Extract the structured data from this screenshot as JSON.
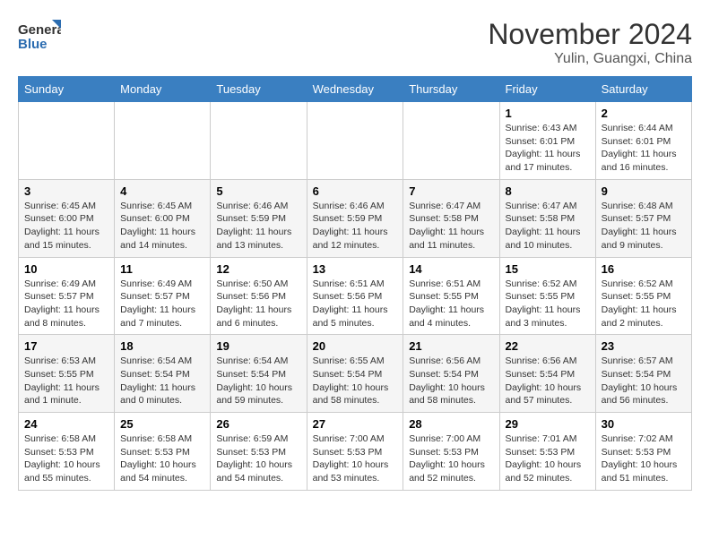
{
  "logo": {
    "line1": "General",
    "line2": "Blue"
  },
  "title": "November 2024",
  "location": "Yulin, Guangxi, China",
  "weekdays": [
    "Sunday",
    "Monday",
    "Tuesday",
    "Wednesday",
    "Thursday",
    "Friday",
    "Saturday"
  ],
  "weeks": [
    [
      {
        "day": "",
        "info": ""
      },
      {
        "day": "",
        "info": ""
      },
      {
        "day": "",
        "info": ""
      },
      {
        "day": "",
        "info": ""
      },
      {
        "day": "",
        "info": ""
      },
      {
        "day": "1",
        "info": "Sunrise: 6:43 AM\nSunset: 6:01 PM\nDaylight: 11 hours and 17 minutes."
      },
      {
        "day": "2",
        "info": "Sunrise: 6:44 AM\nSunset: 6:01 PM\nDaylight: 11 hours and 16 minutes."
      }
    ],
    [
      {
        "day": "3",
        "info": "Sunrise: 6:45 AM\nSunset: 6:00 PM\nDaylight: 11 hours and 15 minutes."
      },
      {
        "day": "4",
        "info": "Sunrise: 6:45 AM\nSunset: 6:00 PM\nDaylight: 11 hours and 14 minutes."
      },
      {
        "day": "5",
        "info": "Sunrise: 6:46 AM\nSunset: 5:59 PM\nDaylight: 11 hours and 13 minutes."
      },
      {
        "day": "6",
        "info": "Sunrise: 6:46 AM\nSunset: 5:59 PM\nDaylight: 11 hours and 12 minutes."
      },
      {
        "day": "7",
        "info": "Sunrise: 6:47 AM\nSunset: 5:58 PM\nDaylight: 11 hours and 11 minutes."
      },
      {
        "day": "8",
        "info": "Sunrise: 6:47 AM\nSunset: 5:58 PM\nDaylight: 11 hours and 10 minutes."
      },
      {
        "day": "9",
        "info": "Sunrise: 6:48 AM\nSunset: 5:57 PM\nDaylight: 11 hours and 9 minutes."
      }
    ],
    [
      {
        "day": "10",
        "info": "Sunrise: 6:49 AM\nSunset: 5:57 PM\nDaylight: 11 hours and 8 minutes."
      },
      {
        "day": "11",
        "info": "Sunrise: 6:49 AM\nSunset: 5:57 PM\nDaylight: 11 hours and 7 minutes."
      },
      {
        "day": "12",
        "info": "Sunrise: 6:50 AM\nSunset: 5:56 PM\nDaylight: 11 hours and 6 minutes."
      },
      {
        "day": "13",
        "info": "Sunrise: 6:51 AM\nSunset: 5:56 PM\nDaylight: 11 hours and 5 minutes."
      },
      {
        "day": "14",
        "info": "Sunrise: 6:51 AM\nSunset: 5:55 PM\nDaylight: 11 hours and 4 minutes."
      },
      {
        "day": "15",
        "info": "Sunrise: 6:52 AM\nSunset: 5:55 PM\nDaylight: 11 hours and 3 minutes."
      },
      {
        "day": "16",
        "info": "Sunrise: 6:52 AM\nSunset: 5:55 PM\nDaylight: 11 hours and 2 minutes."
      }
    ],
    [
      {
        "day": "17",
        "info": "Sunrise: 6:53 AM\nSunset: 5:55 PM\nDaylight: 11 hours and 1 minute."
      },
      {
        "day": "18",
        "info": "Sunrise: 6:54 AM\nSunset: 5:54 PM\nDaylight: 11 hours and 0 minutes."
      },
      {
        "day": "19",
        "info": "Sunrise: 6:54 AM\nSunset: 5:54 PM\nDaylight: 10 hours and 59 minutes."
      },
      {
        "day": "20",
        "info": "Sunrise: 6:55 AM\nSunset: 5:54 PM\nDaylight: 10 hours and 58 minutes."
      },
      {
        "day": "21",
        "info": "Sunrise: 6:56 AM\nSunset: 5:54 PM\nDaylight: 10 hours and 58 minutes."
      },
      {
        "day": "22",
        "info": "Sunrise: 6:56 AM\nSunset: 5:54 PM\nDaylight: 10 hours and 57 minutes."
      },
      {
        "day": "23",
        "info": "Sunrise: 6:57 AM\nSunset: 5:54 PM\nDaylight: 10 hours and 56 minutes."
      }
    ],
    [
      {
        "day": "24",
        "info": "Sunrise: 6:58 AM\nSunset: 5:53 PM\nDaylight: 10 hours and 55 minutes."
      },
      {
        "day": "25",
        "info": "Sunrise: 6:58 AM\nSunset: 5:53 PM\nDaylight: 10 hours and 54 minutes."
      },
      {
        "day": "26",
        "info": "Sunrise: 6:59 AM\nSunset: 5:53 PM\nDaylight: 10 hours and 54 minutes."
      },
      {
        "day": "27",
        "info": "Sunrise: 7:00 AM\nSunset: 5:53 PM\nDaylight: 10 hours and 53 minutes."
      },
      {
        "day": "28",
        "info": "Sunrise: 7:00 AM\nSunset: 5:53 PM\nDaylight: 10 hours and 52 minutes."
      },
      {
        "day": "29",
        "info": "Sunrise: 7:01 AM\nSunset: 5:53 PM\nDaylight: 10 hours and 52 minutes."
      },
      {
        "day": "30",
        "info": "Sunrise: 7:02 AM\nSunset: 5:53 PM\nDaylight: 10 hours and 51 minutes."
      }
    ]
  ]
}
